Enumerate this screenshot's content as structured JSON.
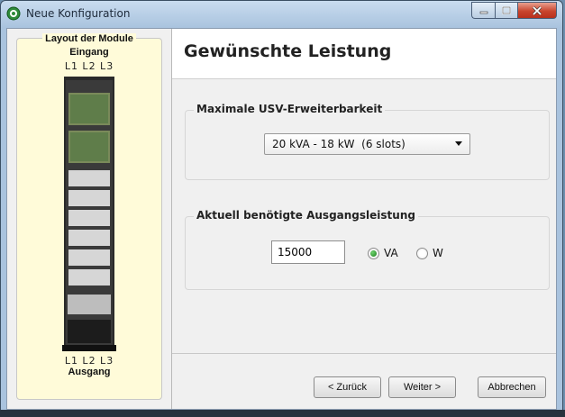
{
  "window": {
    "title": "Neue Konfiguration"
  },
  "left_panel": {
    "title": "Layout der Module",
    "input_label": "Eingang",
    "phases_top": "L1  L2  L3",
    "phases_bottom": "L1  L2  L3",
    "output_label": "Ausgang"
  },
  "header": {
    "title": "Gewünschte Leistung"
  },
  "expandability": {
    "legend": "Maximale USV-Erweiterbarkeit",
    "selected": "20 kVA - 18 kW  (6 slots)"
  },
  "required_power": {
    "legend": "Aktuell benötigte Ausgangsleistung",
    "value": "15000",
    "unit_va": "VA",
    "unit_w": "W",
    "selected_unit": "VA"
  },
  "buttons": {
    "back": "< Zurück",
    "next": "Weiter >",
    "cancel": "Abbrechen"
  }
}
